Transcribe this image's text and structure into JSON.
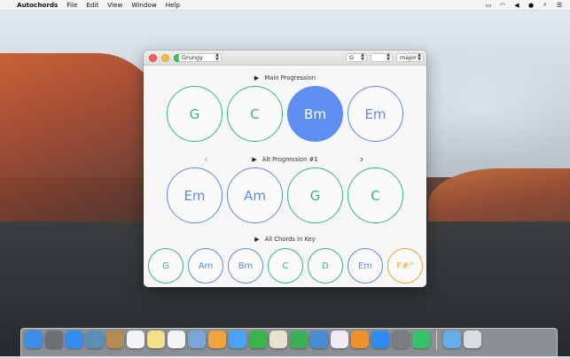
{
  "menubar": {
    "apple": "",
    "app_name": "Autochords",
    "menus": [
      "File",
      "Edit",
      "View",
      "Window",
      "Help"
    ]
  },
  "window": {
    "style_select": "Grungy",
    "key_select": "G",
    "accidental_select": "",
    "mode_select": "major"
  },
  "main_progression": {
    "label": "Main Progression",
    "chords": [
      {
        "name": "G",
        "quality": "major",
        "active": false
      },
      {
        "name": "C",
        "quality": "major",
        "active": false
      },
      {
        "name": "Bm",
        "quality": "minor",
        "active": true
      },
      {
        "name": "Em",
        "quality": "minor",
        "active": false
      }
    ]
  },
  "alt_progression": {
    "label": "Alt Progression #1",
    "chords": [
      {
        "name": "Em",
        "quality": "minor"
      },
      {
        "name": "Am",
        "quality": "minor"
      },
      {
        "name": "G",
        "quality": "major"
      },
      {
        "name": "C",
        "quality": "major"
      }
    ]
  },
  "all_chords": {
    "label": "All Chords in Key",
    "chords": [
      {
        "name": "G",
        "quality": "major"
      },
      {
        "name": "Am",
        "quality": "minor"
      },
      {
        "name": "Bm",
        "quality": "minor"
      },
      {
        "name": "C",
        "quality": "major"
      },
      {
        "name": "D",
        "quality": "major"
      },
      {
        "name": "Em",
        "quality": "minor"
      },
      {
        "name": "F#°",
        "quality": "diminished"
      }
    ]
  },
  "colors": {
    "major": "#3dbf84",
    "minor": "#6e95e9",
    "diminished": "#f3a53a",
    "active": "#5d8ef0"
  },
  "dock": {
    "items": [
      {
        "icon": "finder-icon",
        "color": "#3b8de8"
      },
      {
        "icon": "launchpad-icon",
        "color": "#6d7074"
      },
      {
        "icon": "safari-icon",
        "color": "#2f8ef0"
      },
      {
        "icon": "preview-photos-icon",
        "color": "#5a8fb8"
      },
      {
        "icon": "contacts-icon",
        "color": "#b58a53"
      },
      {
        "icon": "calendar-icon",
        "color": "#f4f4f4"
      },
      {
        "icon": "notes-icon",
        "color": "#f5e08a"
      },
      {
        "icon": "reminders-icon",
        "color": "#f4f4f4"
      },
      {
        "icon": "photo-booth-icon",
        "color": "#7aa6d6"
      },
      {
        "icon": "photos-icon",
        "color": "#f0a43c"
      },
      {
        "icon": "messages-icon",
        "color": "#4aa3f5"
      },
      {
        "icon": "facetime-icon",
        "color": "#38b64a"
      },
      {
        "icon": "pages-icon",
        "color": "#e9e1cf"
      },
      {
        "icon": "numbers-icon",
        "color": "#3fae59"
      },
      {
        "icon": "keynote-icon",
        "color": "#4a8bd6"
      },
      {
        "icon": "itunes-icon",
        "color": "#f0eaf5"
      },
      {
        "icon": "ibooks-icon",
        "color": "#f0922b"
      },
      {
        "icon": "app-store-icon",
        "color": "#2e8bef"
      },
      {
        "icon": "system-preferences-icon",
        "color": "#7a7d82"
      },
      {
        "icon": "autochords-icon",
        "color": "#34c36a"
      },
      {
        "icon": "downloads-folder-icon",
        "color": "#63aee6"
      },
      {
        "icon": "trash-icon",
        "color": "#d9dde2"
      }
    ]
  }
}
